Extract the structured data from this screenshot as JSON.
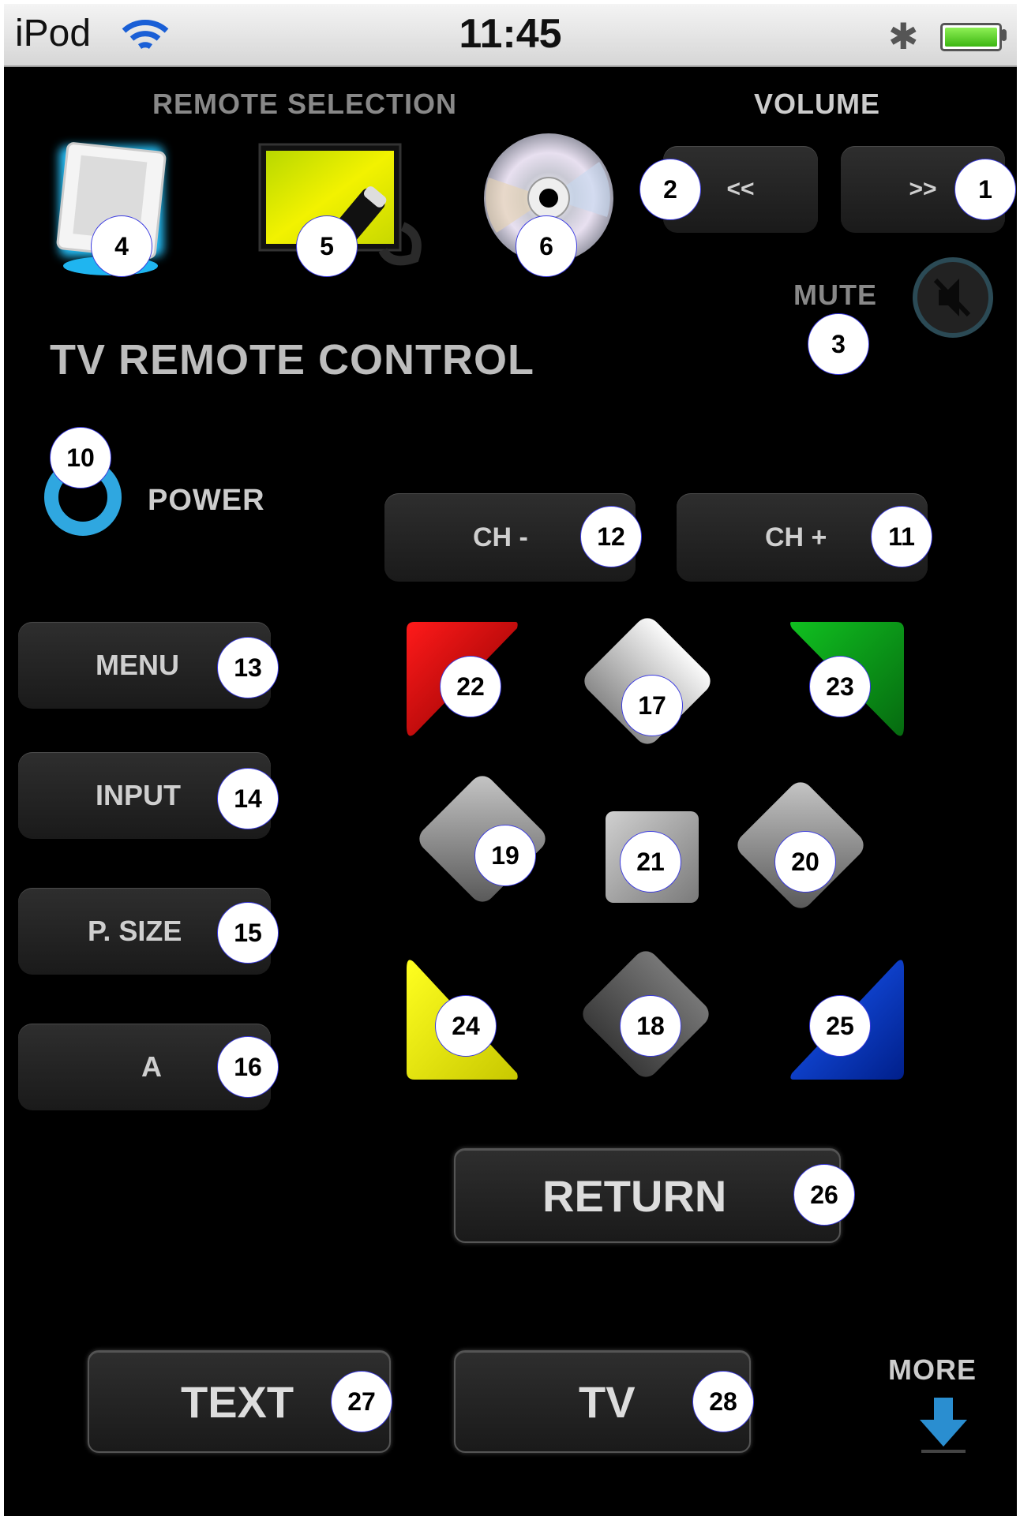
{
  "status_bar": {
    "carrier": "iPod",
    "time": "11:45"
  },
  "remote_selection": {
    "label": "REMOTE SELECTION",
    "devices": [
      "tv-device-icon",
      "projector-device-icon",
      "dvd-disc-icon"
    ]
  },
  "volume": {
    "label": "VOLUME",
    "down_label": "<<",
    "up_label": ">>"
  },
  "mute": {
    "label": "MUTE"
  },
  "title": "TV REMOTE CONTROL",
  "power": {
    "label": "POWER"
  },
  "channel": {
    "down_label": "CH -",
    "up_label": "CH +"
  },
  "side_buttons": {
    "menu": "MENU",
    "input": "INPUT",
    "psize": "P. SIZE",
    "a": "A"
  },
  "return_label": "RETURN",
  "bottom": {
    "text_label": "TEXT",
    "tv_label": "TV",
    "more_label": "MORE"
  },
  "badges": {
    "b1": "1",
    "b2": "2",
    "b3": "3",
    "b4": "4",
    "b5": "5",
    "b6": "6",
    "b10": "10",
    "b11": "11",
    "b12": "12",
    "b13": "13",
    "b14": "14",
    "b15": "15",
    "b16": "16",
    "b17": "17",
    "b18": "18",
    "b19": "19",
    "b20": "20",
    "b21": "21",
    "b22": "22",
    "b23": "23",
    "b24": "24",
    "b25": "25",
    "b26": "26",
    "b27": "27",
    "b28": "28"
  },
  "colors": {
    "red_key": "#cc0000",
    "green_key": "#10a01a",
    "yellow_key": "#f2f200",
    "blue_key": "#0a3fc0",
    "power_ring": "#2fa7e0"
  }
}
